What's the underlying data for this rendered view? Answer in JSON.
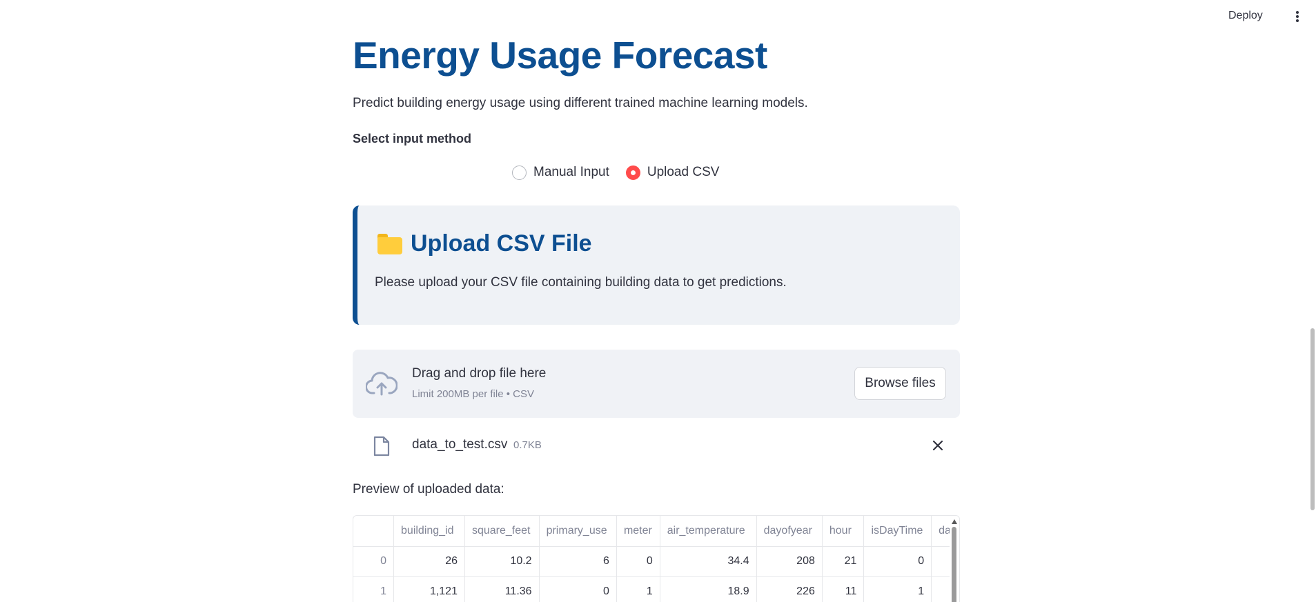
{
  "header": {
    "deploy_label": "Deploy"
  },
  "page": {
    "title": "Energy Usage Forecast",
    "subtitle": "Predict building energy usage using different trained machine learning models.",
    "select_label": "Select input method"
  },
  "input_method": {
    "options": [
      "Manual Input",
      "Upload CSV"
    ],
    "selected": "Upload CSV"
  },
  "upload_card": {
    "icon": "folder-icon",
    "heading": "Upload CSV File",
    "text": "Please upload your CSV file containing building data to get predictions."
  },
  "uploader": {
    "title": "Drag and drop file here",
    "subtitle": "Limit 200MB per file • CSV",
    "button_label": "Browse files",
    "file_name": "data_to_test.csv",
    "file_size": "0.7KB"
  },
  "preview": {
    "label": "Preview of uploaded data:",
    "columns": [
      "",
      "building_id",
      "square_feet",
      "primary_use",
      "meter",
      "air_temperature",
      "dayofyear",
      "hour",
      "isDayTime",
      "da"
    ],
    "rows": [
      [
        "0",
        "26",
        "10.2",
        "6",
        "0",
        "34.4",
        "208",
        "21",
        "0",
        ""
      ],
      [
        "1",
        "1,121",
        "11.36",
        "0",
        "1",
        "18.9",
        "226",
        "11",
        "1",
        ""
      ]
    ]
  },
  "colors": {
    "brand_blue": "#0d4f91",
    "radio_selected": "#ff4b4b",
    "card_bg": "#eff2f6"
  }
}
